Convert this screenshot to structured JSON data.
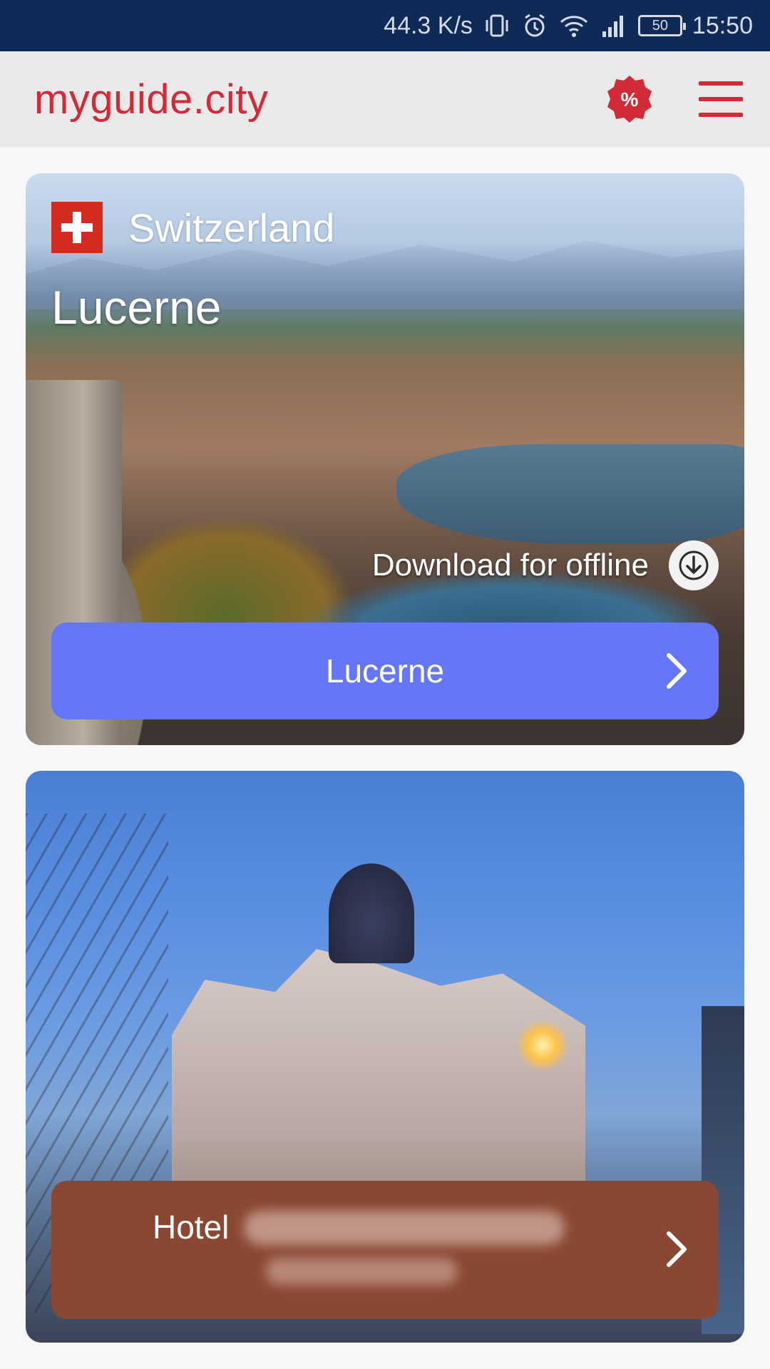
{
  "status_bar": {
    "speed": "44.3 K/s",
    "battery": "50",
    "time": "15:50",
    "icons": [
      "vibrate-icon",
      "alarm-icon",
      "wifi-icon",
      "signal-icon",
      "battery-icon"
    ]
  },
  "header": {
    "brand": "myguide.city",
    "promo_symbol": "%",
    "icons": [
      "discount-badge-icon",
      "hamburger-menu-icon"
    ],
    "colors": {
      "brand": "#d22a36",
      "background": "#e9e9ea"
    }
  },
  "cards": [
    {
      "country": "Switzerland",
      "city": "Lucerne",
      "download_label": "Download for offline",
      "button_label": "Lucerne",
      "button_color": "#6476f9"
    },
    {
      "button_label": "Hotel",
      "button_color": "#8a4732"
    }
  ]
}
